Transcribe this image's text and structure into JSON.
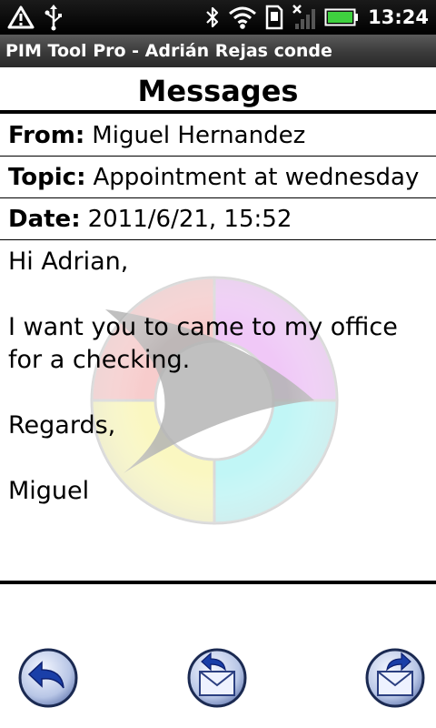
{
  "status_bar": {
    "time": "13:24",
    "icons": [
      "warning-icon",
      "usb-icon",
      "bluetooth-icon",
      "wifi-icon",
      "sd-card-icon",
      "no-signal-icon",
      "battery-icon"
    ]
  },
  "app": {
    "title": "PIM Tool Pro - Adrián Rejas conde"
  },
  "header": {
    "title": "Messages"
  },
  "message": {
    "from_label": "From:",
    "from": "Miguel Hernandez",
    "topic_label": "Topic:",
    "topic": "Appointment at wednesday",
    "date_label": "Date:",
    "date": "2011/6/21, 15:52",
    "body": "Hi Adrian,\n\nI want you to came to my office\nfor a checking.\n\nRegards,\n\nMiguel"
  },
  "toolbar": {
    "buttons": [
      "back-icon",
      "reply-icon",
      "forward-icon"
    ]
  },
  "colors": {
    "status_bar": "#000000",
    "title_bar": "#3a3a3a",
    "button_blue": "#1a3fa8"
  }
}
